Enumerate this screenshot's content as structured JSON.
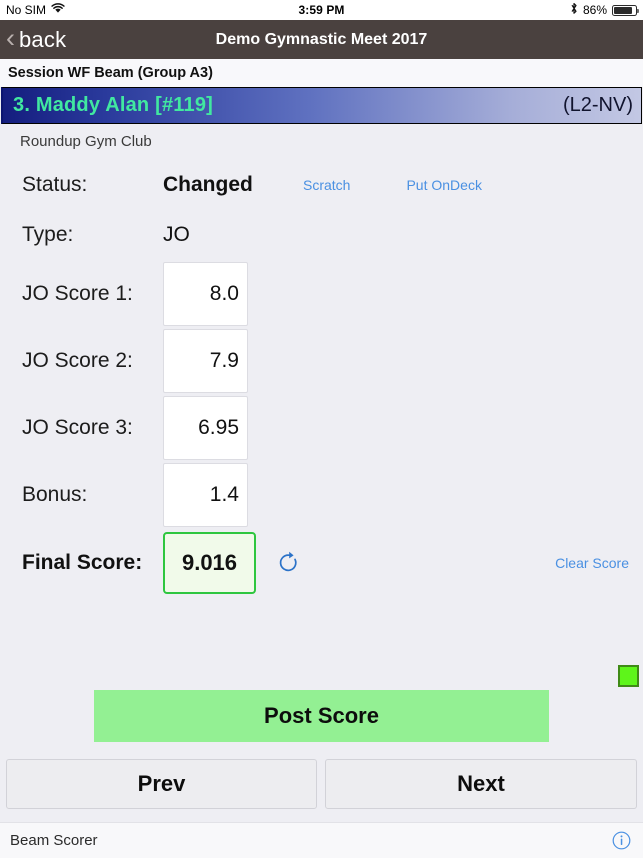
{
  "status_bar": {
    "carrier": "No SIM",
    "wifi_icon": "wifi-icon",
    "time": "3:59 PM",
    "bluetooth_icon": "bluetooth-icon",
    "battery_percent": "86%",
    "battery_icon": "battery-icon"
  },
  "nav_bar": {
    "back_label": "back",
    "back_chevron_icon": "chevron-left-icon",
    "title": "Demo Gymnastic Meet 2017"
  },
  "session": {
    "header": "Session WF Beam (Group A3)"
  },
  "athlete": {
    "name": "3. Maddy Alan [#119]",
    "level": "(L2-NV)",
    "club": "Roundup Gym Club"
  },
  "form": {
    "status_label": "Status:",
    "status_value": "Changed",
    "scratch_link": "Scratch",
    "ondeck_link": "Put OnDeck",
    "type_label": "Type:",
    "type_value": "JO",
    "scores": [
      {
        "label": "JO Score 1:",
        "value": "8.0"
      },
      {
        "label": "JO Score 2:",
        "value": "7.9"
      },
      {
        "label": "JO Score 3:",
        "value": "6.95"
      },
      {
        "label": "Bonus:",
        "value": "1.4"
      }
    ],
    "final_label": "Final Score:",
    "final_value": "9.016",
    "recalculate_icon": "refresh-icon",
    "clear_link": "Clear Score"
  },
  "indicator": {
    "name": "connection-status-indicator",
    "color": "#5EF51A"
  },
  "actions": {
    "post_score": "Post Score",
    "prev": "Prev",
    "next": "Next"
  },
  "footer": {
    "title": "Beam Scorer",
    "info_icon": "info-icon"
  },
  "colors": {
    "accent_link": "#4A90E2",
    "nav_bar": "#4A413F",
    "athlete_name": "#41E8A0",
    "post_button": "#93F093",
    "final_border": "#2EC63F"
  }
}
